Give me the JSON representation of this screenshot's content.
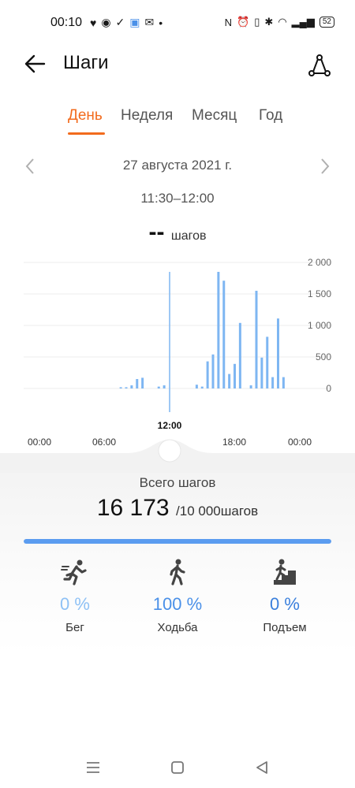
{
  "status_bar": {
    "time": "00:10",
    "battery": "52"
  },
  "header": {
    "title": "Шаги"
  },
  "tabs": [
    {
      "label": "День",
      "active": true
    },
    {
      "label": "Неделя",
      "active": false
    },
    {
      "label": "Месяц",
      "active": false
    },
    {
      "label": "Год",
      "active": false
    }
  ],
  "date": "27 августа 2021 г.",
  "time_range": "11:30–12:00",
  "selected_value": "--",
  "selected_unit": "шагов",
  "chart_data": {
    "type": "bar",
    "y_ticks": [
      "2 000",
      "1 500",
      "1 000",
      "500",
      "0"
    ],
    "ylim": [
      0,
      2000
    ],
    "x_ticks": [
      "00:00",
      "06:00",
      "12:00",
      "18:00",
      "00:00"
    ],
    "selected_label": "12:00",
    "bar_color": "#7eb6f2",
    "bars": [
      {
        "t": "07:30",
        "v": 20
      },
      {
        "t": "08:00",
        "v": 20
      },
      {
        "t": "08:30",
        "v": 50
      },
      {
        "t": "09:00",
        "v": 150
      },
      {
        "t": "09:30",
        "v": 170
      },
      {
        "t": "11:00",
        "v": 30
      },
      {
        "t": "11:30",
        "v": 50
      },
      {
        "t": "14:30",
        "v": 60
      },
      {
        "t": "15:00",
        "v": 30
      },
      {
        "t": "15:30",
        "v": 430
      },
      {
        "t": "16:00",
        "v": 540
      },
      {
        "t": "16:30",
        "v": 1850
      },
      {
        "t": "17:00",
        "v": 1710
      },
      {
        "t": "17:30",
        "v": 230
      },
      {
        "t": "18:00",
        "v": 390
      },
      {
        "t": "18:30",
        "v": 1040
      },
      {
        "t": "19:30",
        "v": 50
      },
      {
        "t": "20:00",
        "v": 1550
      },
      {
        "t": "20:30",
        "v": 490
      },
      {
        "t": "21:00",
        "v": 820
      },
      {
        "t": "21:30",
        "v": 180
      },
      {
        "t": "22:00",
        "v": 1110
      },
      {
        "t": "22:30",
        "v": 180
      }
    ]
  },
  "summary": {
    "label": "Всего шагов",
    "total": "16 173",
    "goal": "/10 000шагов",
    "progress": 1.0,
    "progress_color": "#5b9cf0"
  },
  "activities": [
    {
      "pct": "0 %",
      "label": "Бег",
      "icon": "running-icon",
      "color": "#8ec1f5"
    },
    {
      "pct": "100 %",
      "label": "Ходьба",
      "icon": "walking-icon",
      "color": "#4a90e8"
    },
    {
      "pct": "0 %",
      "label": "Подъем",
      "icon": "climbing-icon",
      "color": "#3a7fdc"
    }
  ]
}
